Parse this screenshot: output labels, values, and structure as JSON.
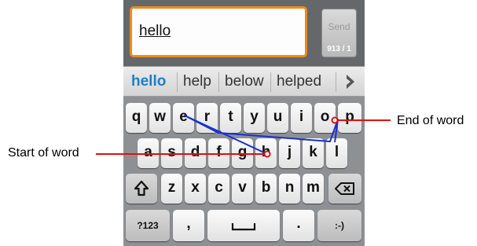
{
  "compose": {
    "text": "hello",
    "send_label": "Send",
    "counter": "913 / 1"
  },
  "suggestions": {
    "items": [
      "hello",
      "help",
      "below",
      "helped"
    ],
    "more_icon": "chevron-right-icon"
  },
  "keyboard": {
    "row1": [
      "q",
      "w",
      "e",
      "r",
      "t",
      "y",
      "u",
      "i",
      "o",
      "p"
    ],
    "row2": [
      "a",
      "s",
      "d",
      "f",
      "g",
      "h",
      "j",
      "k",
      "l"
    ],
    "row3": [
      "z",
      "x",
      "c",
      "v",
      "b",
      "n",
      "m"
    ],
    "shift_icon": "shift-icon",
    "backspace_icon": "backspace-icon",
    "symbols_label": "?123",
    "comma_label": ",",
    "space_icon": "space-icon",
    "period_label": ".",
    "smiley_label": ":-)"
  },
  "annotations": {
    "start_label": "Start of word",
    "end_label": "End of word",
    "path_color": "#1a2fd1",
    "marker_color": "#e01010"
  },
  "colors": {
    "accent_orange": "#f08a17",
    "suggestion_highlight": "#1e7fc8"
  }
}
